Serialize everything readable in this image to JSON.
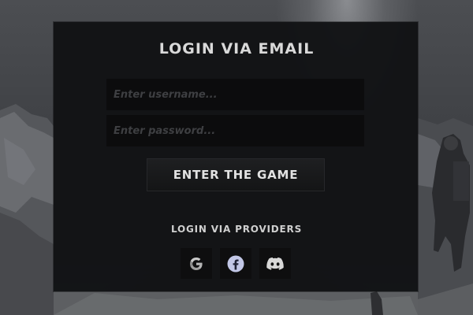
{
  "login": {
    "title": "LOGIN VIA EMAIL",
    "username_placeholder": "Enter username...",
    "password_placeholder": "Enter password...",
    "enter_button": "ENTER THE GAME"
  },
  "providers": {
    "label": "LOGIN VIA PROVIDERS",
    "items": [
      {
        "name": "google-icon"
      },
      {
        "name": "facebook-icon",
        "color": "#c2c7e6"
      },
      {
        "name": "discord-icon"
      }
    ]
  }
}
